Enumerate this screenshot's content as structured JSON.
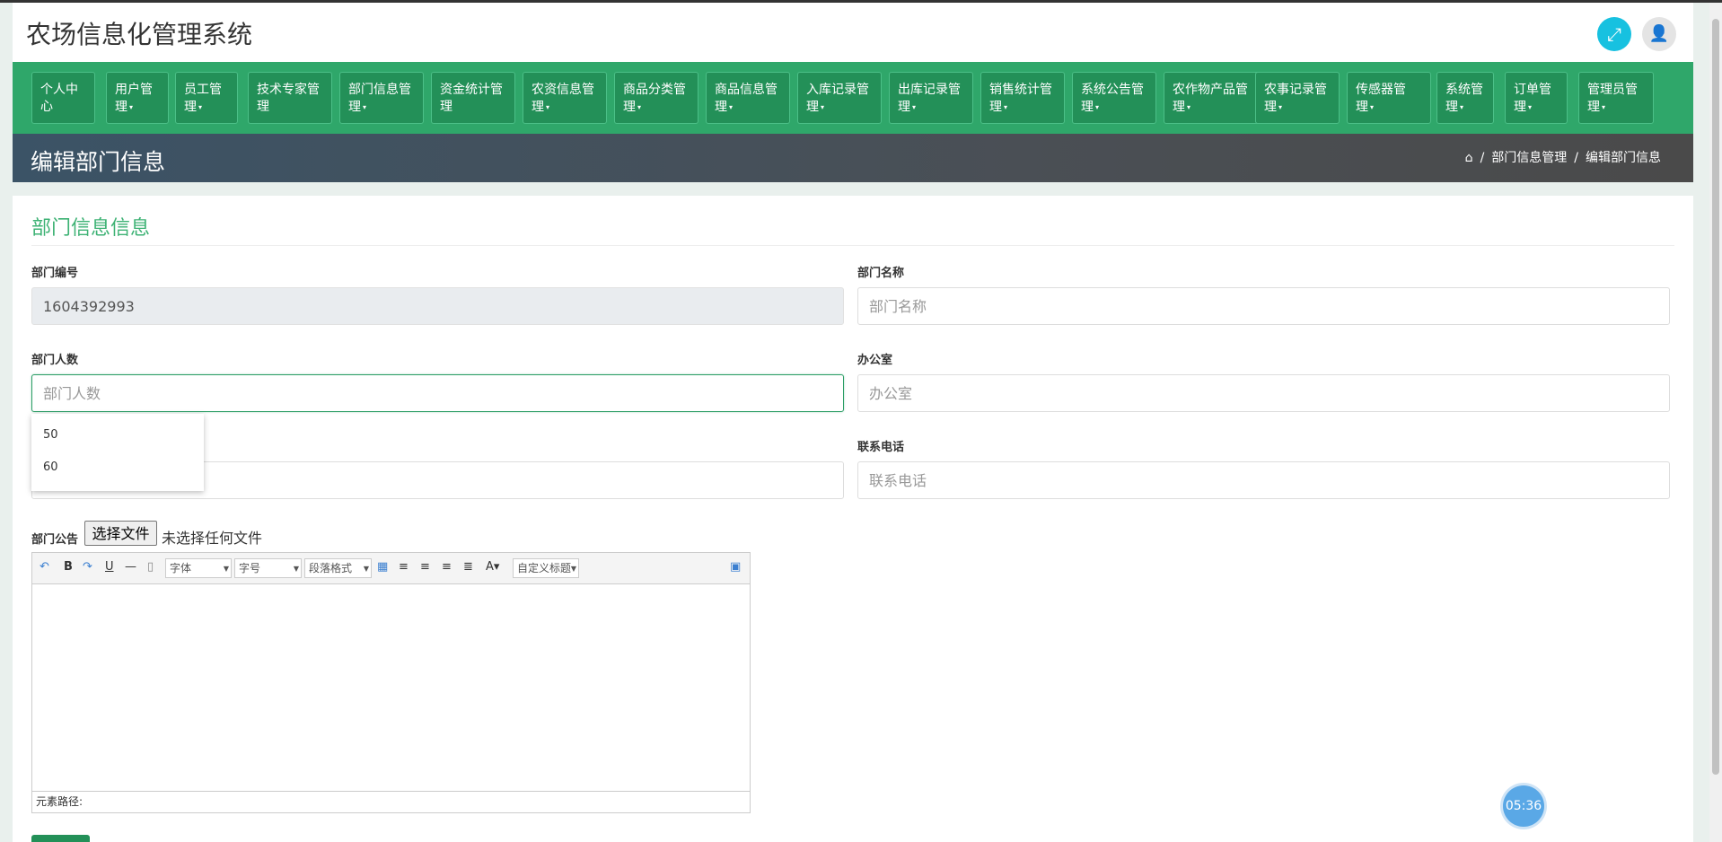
{
  "app": {
    "title": "农场信息化管理系统"
  },
  "nav": {
    "items": [
      {
        "label": "个人中\n心",
        "caret": false
      },
      {
        "label": "用户管\n理",
        "caret": true
      },
      {
        "label": "员工管\n理",
        "caret": true
      },
      {
        "label": "技术专家管\n理",
        "caret": false
      },
      {
        "label": "部门信息管\n理",
        "caret": true
      },
      {
        "label": "资金统计管\n理",
        "caret": false
      },
      {
        "label": "农资信息管\n理",
        "caret": true
      },
      {
        "label": "商品分类管\n理",
        "caret": true
      },
      {
        "label": "商品信息管\n理",
        "caret": true
      },
      {
        "label": "入库记录管\n理",
        "caret": true
      },
      {
        "label": "出库记录管\n理",
        "caret": true
      },
      {
        "label": "销售统计管\n理",
        "caret": true
      },
      {
        "label": "系统公告管\n理",
        "caret": true
      },
      {
        "label": "农作物产品管\n理",
        "caret": true
      },
      {
        "label": "农事记录管\n理",
        "caret": true
      },
      {
        "label": "传感器管\n理",
        "caret": true
      },
      {
        "label": "系统管\n理",
        "caret": true
      },
      {
        "label": "订单管\n理",
        "caret": true
      },
      {
        "label": "管理员管\n理",
        "caret": true
      }
    ]
  },
  "page": {
    "title": "编辑部门信息",
    "breadcrumb": [
      "部门信息管理",
      "编辑部门信息"
    ]
  },
  "form": {
    "section_title": "部门信息信息",
    "dept_no": {
      "label": "部门编号",
      "value": "1604392993"
    },
    "dept_name": {
      "label": "部门名称",
      "placeholder": "部门名称"
    },
    "dept_count": {
      "label": "部门人数",
      "placeholder": "部门人数",
      "suggestions": [
        "50",
        "60"
      ]
    },
    "office": {
      "label": "办公室",
      "placeholder": "办公室"
    },
    "phone": {
      "label": "联系电话",
      "placeholder": "联系电话"
    },
    "notice": {
      "label": "部门公告",
      "file_button": "选择文件",
      "file_status": "未选择任何文件"
    }
  },
  "editor": {
    "font_select": "字体",
    "size_select": "字号",
    "para_select": "段落格式",
    "custom_title": "自定义标题",
    "path_label": "元素路径:"
  },
  "timer": "05:36"
}
